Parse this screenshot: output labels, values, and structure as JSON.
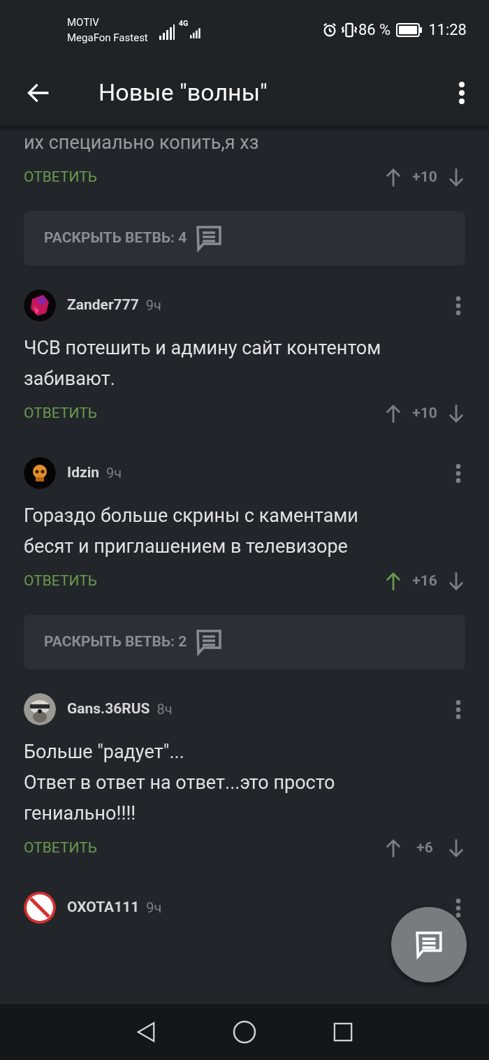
{
  "status_bar": {
    "carrier_1": "MOTIV",
    "carrier_2": "MegaFon Fastest",
    "network": "4G",
    "battery": "86 %",
    "time": "11:28"
  },
  "app_bar": {
    "title": "Новые \"волны\""
  },
  "thread": [
    {
      "kind": "tail",
      "lines": [
        "их специально копить,я хз"
      ],
      "reply": "ОТВЕТИТЬ",
      "score": "+10",
      "upvoted": false
    },
    {
      "kind": "expand",
      "label": "РАСКРЫТЬ ВЕТВЬ: 4"
    },
    {
      "kind": "comment",
      "author": "Zander777",
      "time": "9ч",
      "lines": [
        "ЧСВ потешить и админу сайт контентом",
        "забивают."
      ],
      "reply": "ОТВЕТИТЬ",
      "score": "+10",
      "upvoted": false
    },
    {
      "kind": "comment",
      "author": "Idzin",
      "time": "9ч",
      "lines": [
        "Гораздо больше скрины с каментами",
        "бесят и приглашением в телевизоре"
      ],
      "reply": "ОТВЕТИТЬ",
      "score": "+16",
      "upvoted": true
    },
    {
      "kind": "expand",
      "label": "РАСКРЫТЬ ВЕТВЬ: 2"
    },
    {
      "kind": "comment",
      "author": "Gans.36RUS",
      "time": "8ч",
      "lines": [
        "Больше \"радует\"...",
        "Ответ в ответ на ответ...это просто",
        "гениально!!!!"
      ],
      "reply": "ОТВЕТИТЬ",
      "score": "+6",
      "upvoted": false
    },
    {
      "kind": "header",
      "author": "OXOTA111",
      "time": "9ч"
    }
  ]
}
